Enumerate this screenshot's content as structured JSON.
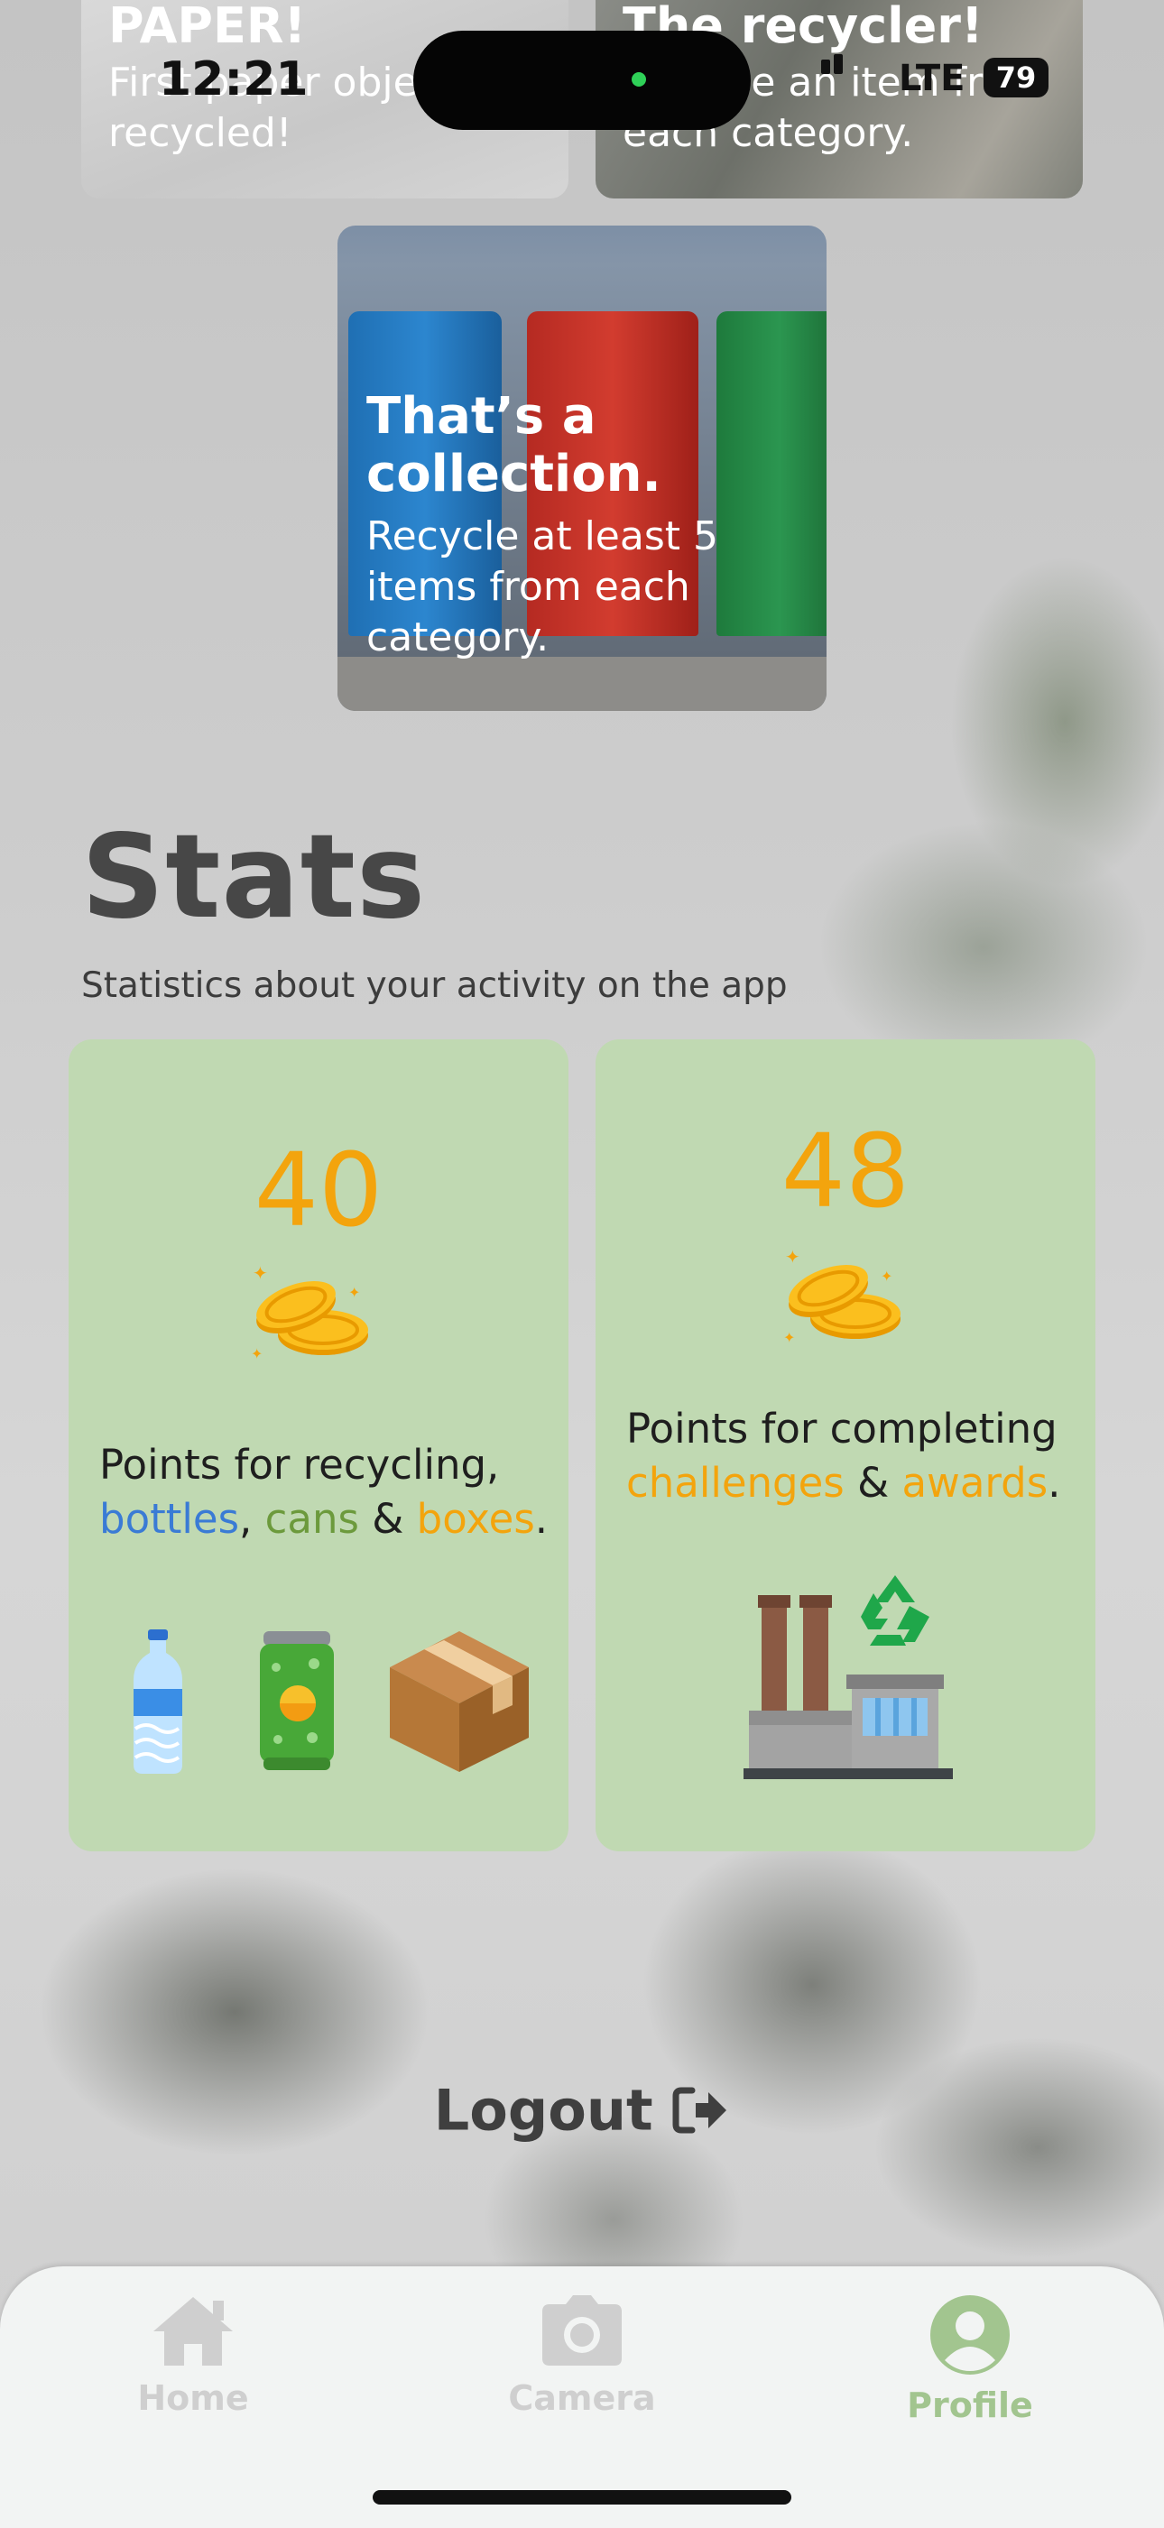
{
  "status_bar": {
    "time": "12:21",
    "network": "LTE",
    "battery": "79"
  },
  "awards": [
    {
      "title": "PAPER!",
      "description": "First paper object recycled!"
    },
    {
      "title": "The recycler!",
      "description": "Recycle an item from each category."
    },
    {
      "title": "That’s a collection.",
      "description": "Recycle at least 5 items from each category."
    }
  ],
  "stats": {
    "title": "Stats",
    "subtitle": "Statistics about your activity on the app",
    "recycling_card": {
      "points": "40",
      "text_prefix": "Points for recycling,",
      "item_1": "bottles",
      "sep_1": ",",
      "item_2": "cans",
      "sep_2": "&",
      "item_3": "boxes",
      "end": "."
    },
    "challenges_card": {
      "points": "48",
      "text_prefix": "Points for completing",
      "item_1": "challenges",
      "sep_1": "&",
      "item_2": "awards",
      "end": "."
    }
  },
  "logout": {
    "label": "Logout"
  },
  "tabs": [
    {
      "label": "Home",
      "icon": "home-icon",
      "active": false
    },
    {
      "label": "Camera",
      "icon": "camera-icon",
      "active": false
    },
    {
      "label": "Profile",
      "icon": "profile-icon",
      "active": true
    }
  ],
  "colors": {
    "accent_green": "#a2c58f",
    "inactive_tab": "#cfcfcf",
    "points_orange": "#f3a40d",
    "card_green": "#c0d9b2",
    "bottles_blue": "#3a7bd5",
    "cans_green": "#6c9a3c"
  }
}
